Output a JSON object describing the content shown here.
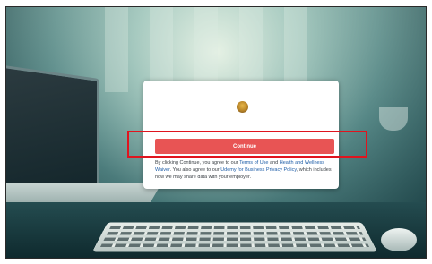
{
  "modal": {
    "logo_icon": "organization-logo-icon",
    "continue_label": "Continue",
    "disclaimer": {
      "part1": "By clicking Continue, you agree to our ",
      "terms_link": "Terms of Use",
      "part2": " and ",
      "waiver_link": "Health and Wellness Waiver",
      "part3": ". You also agree to our ",
      "privacy_link": "Udemy for Business Privacy Policy",
      "part4": ", which includes how we may share data with your employer."
    }
  },
  "colors": {
    "button": "#e85454",
    "highlight_box": "#e0141e",
    "link": "#1f5ea8"
  }
}
